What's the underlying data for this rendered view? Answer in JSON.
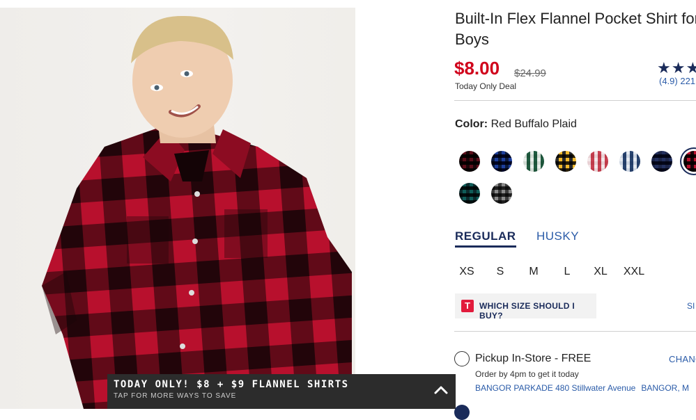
{
  "product": {
    "title_line1": "Built-In Flex Flannel Pocket Shirt for",
    "title_line2": "Boys",
    "price": "$8.00",
    "original_price": "$24.99",
    "deal_label": "Today Only Deal",
    "rating_stars": "★★★★",
    "rating_text": "(4.9) 221"
  },
  "color": {
    "label": "Color:",
    "selected": "Red Buffalo Plaid",
    "swatches": [
      {
        "name": "red-black-plaid",
        "colors": [
          "#5a0e1a",
          "#1a0508"
        ]
      },
      {
        "name": "blue-plaid",
        "colors": [
          "#1d3f9a",
          "#0b1a3d"
        ]
      },
      {
        "name": "green-white-plaid",
        "colors": [
          "#1f5a3f",
          "#e7ece8"
        ]
      },
      {
        "name": "yellow-black-plaid",
        "colors": [
          "#f2b92b",
          "#2a2a2a"
        ]
      },
      {
        "name": "red-white-plaid",
        "colors": [
          "#c84050",
          "#f3e6e8"
        ]
      },
      {
        "name": "navy-white-plaid",
        "colors": [
          "#27436f",
          "#e4e9f0"
        ]
      },
      {
        "name": "navy-solid",
        "colors": [
          "#23305e",
          "#1b2447"
        ]
      },
      {
        "name": "red-buffalo-plaid",
        "colors": [
          "#b8102d",
          "#1a0508"
        ]
      },
      {
        "name": "teal-plaid",
        "colors": [
          "#0f5c58",
          "#0c2a2c"
        ]
      },
      {
        "name": "gray-plaid",
        "colors": [
          "#8a8a8a",
          "#3a3a3a"
        ]
      }
    ]
  },
  "fit_tabs": [
    "REGULAR",
    "HUSKY"
  ],
  "sizes": [
    "XS",
    "S",
    "M",
    "L",
    "XL",
    "XXL"
  ],
  "size_help": {
    "icon": "T",
    "label": "WHICH SIZE SHOULD I BUY?",
    "chart_link": "SI"
  },
  "pickup": {
    "label": "Pickup In-Store - FREE",
    "change": "CHANG",
    "order_by": "Order by 4pm to get it today",
    "store": "BANGOR PARKADE 480 Stillwater Avenue",
    "city": "BANGOR, M"
  },
  "promo": {
    "title": "TODAY ONLY! $8 + $9 FLANNEL SHIRTS",
    "subtitle": "TAP FOR MORE WAYS TO SAVE"
  }
}
